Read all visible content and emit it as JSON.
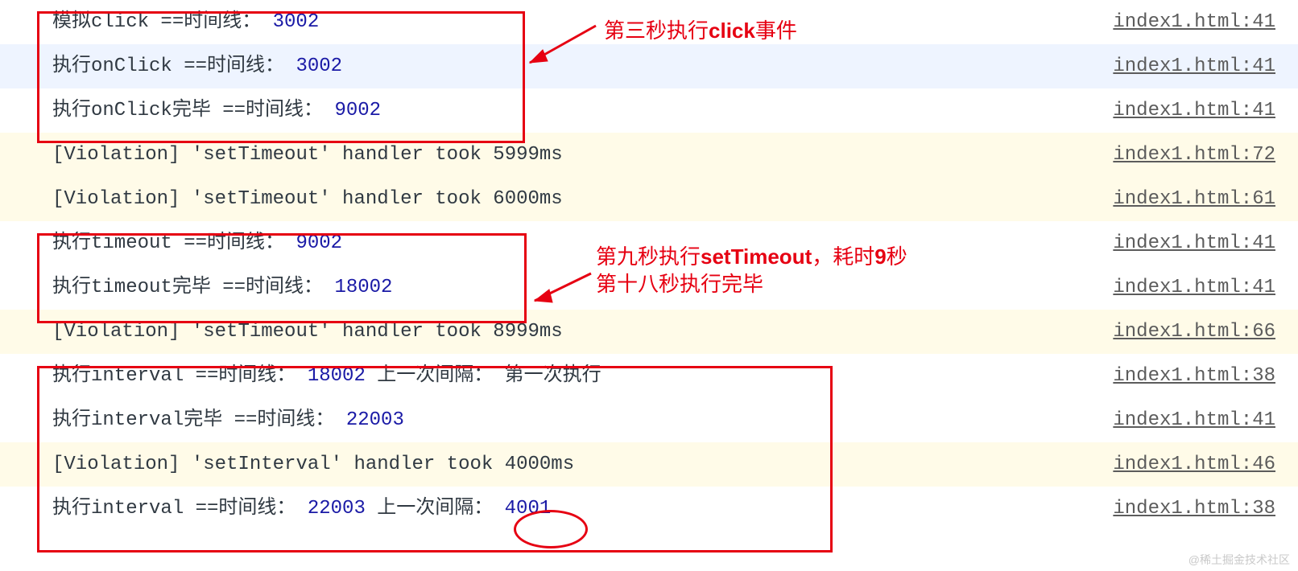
{
  "rows": [
    {
      "type": "log",
      "bg": "",
      "segs": [
        {
          "t": "模拟click ==时间线：  ",
          "c": "ink"
        },
        {
          "t": "3002",
          "c": "num"
        }
      ],
      "src": "index1.html:41"
    },
    {
      "type": "log",
      "bg": "alt",
      "segs": [
        {
          "t": "执行onClick ==时间线：  ",
          "c": "ink"
        },
        {
          "t": "3002",
          "c": "num"
        }
      ],
      "src": "index1.html:41"
    },
    {
      "type": "log",
      "bg": "",
      "segs": [
        {
          "t": "执行onClick完毕 ==时间线：  ",
          "c": "ink"
        },
        {
          "t": "9002",
          "c": "num"
        }
      ],
      "src": "index1.html:41"
    },
    {
      "type": "v",
      "bg": "violet",
      "segs": [
        {
          "t": "[Violation] 'setTimeout' handler took 5999ms",
          "c": "ink"
        }
      ],
      "src": "index1.html:72"
    },
    {
      "type": "v",
      "bg": "violet",
      "segs": [
        {
          "t": "[Violation] 'setTimeout' handler took 6000ms",
          "c": "ink"
        }
      ],
      "src": "index1.html:61"
    },
    {
      "type": "log",
      "bg": "",
      "segs": [
        {
          "t": "执行timeout ==时间线：  ",
          "c": "ink"
        },
        {
          "t": "9002",
          "c": "num"
        }
      ],
      "src": "index1.html:41"
    },
    {
      "type": "log",
      "bg": "",
      "segs": [
        {
          "t": "执行timeout完毕 ==时间线：  ",
          "c": "ink"
        },
        {
          "t": "18002",
          "c": "num"
        }
      ],
      "src": "index1.html:41"
    },
    {
      "type": "v",
      "bg": "violet",
      "segs": [
        {
          "t": "[Violation] 'setTimeout' handler took 8999ms",
          "c": "ink"
        }
      ],
      "src": "index1.html:66"
    },
    {
      "type": "log",
      "bg": "",
      "segs": [
        {
          "t": "执行interval ==时间线：  ",
          "c": "ink"
        },
        {
          "t": "18002",
          "c": "num"
        },
        {
          "t": " 上一次间隔：  第一次执行",
          "c": "ink"
        }
      ],
      "src": "index1.html:38"
    },
    {
      "type": "log",
      "bg": "",
      "segs": [
        {
          "t": "执行interval完毕 ==时间线：  ",
          "c": "ink"
        },
        {
          "t": "22003",
          "c": "num"
        }
      ],
      "src": "index1.html:41"
    },
    {
      "type": "v",
      "bg": "violet",
      "segs": [
        {
          "t": "[Violation] 'setInterval' handler took 4000ms",
          "c": "ink"
        }
      ],
      "src": "index1.html:46"
    },
    {
      "type": "log",
      "bg": "",
      "segs": [
        {
          "t": "执行interval ==时间线：  ",
          "c": "ink"
        },
        {
          "t": "22003",
          "c": "num"
        },
        {
          "t": " 上一次间隔：  ",
          "c": "ink"
        },
        {
          "t": "4001",
          "c": "num"
        }
      ],
      "src": "index1.html:38"
    }
  ],
  "annotations": {
    "a1_pre": "第三秒执行",
    "a1_bold": "click",
    "a1_post": "事件",
    "a2_line1_pre": "第九秒执行",
    "a2_line1_bold": "setTimeout",
    "a2_line1_post": "，耗时",
    "a2_line1_bold2": "9",
    "a2_line1_post2": "秒",
    "a2_line2": "第十八秒执行完毕"
  },
  "watermark": "@稀土掘金技术社区"
}
